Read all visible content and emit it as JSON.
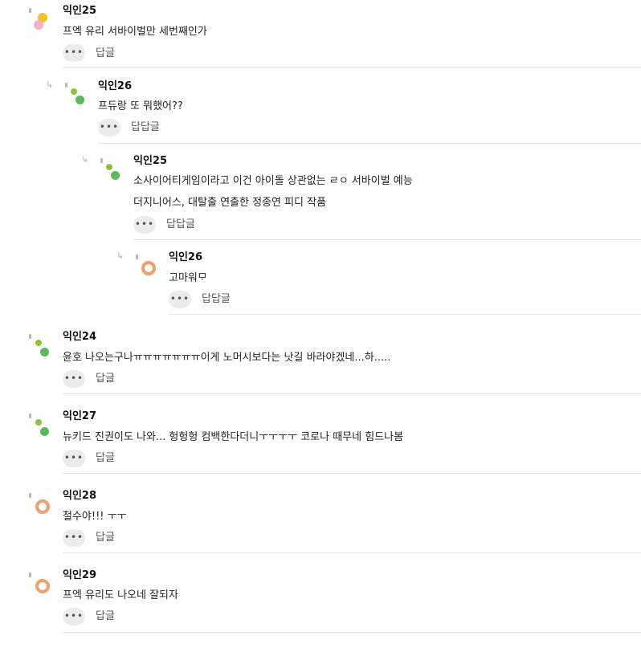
{
  "more_icon_glyph": "•••",
  "reply_arrow_glyph": "↳",
  "colors": {
    "green": "#5cb85c",
    "lime": "#8fc33b",
    "orange": "#f0a06a",
    "yellow": "#f5c21b",
    "pink": "#f3b2c8"
  },
  "comments": [
    {
      "author": "익인25",
      "lines": [
        "프엑 유리 서바이벌만 세번째인가"
      ],
      "reply_label": "답글",
      "avatar": "yellow-pink"
    },
    {
      "author": "익인26",
      "lines": [
        "프듀랑 또 뭐했어??"
      ],
      "reply_label": "답답글",
      "avatar": "green-lime"
    },
    {
      "author": "익인25",
      "lines": [
        "소사이어티게임이라고 이건 아이돌 상관없는 ㄹㅇ 서바이벌 예능",
        "더지니어스, 대탈출 연출한 정종연 피디 작품"
      ],
      "reply_label": "답답글",
      "avatar": "green-lime"
    },
    {
      "author": "익인26",
      "lines": [
        "고마워ᄆᆞ"
      ],
      "reply_label": "답답글",
      "avatar": "orange"
    },
    {
      "author": "익인24",
      "lines": [
        "윤호 나오는구나ㅠㅠㅠㅠㅠㅠㅠ이게 노머시보다는 낫길 바라야겠네...하....."
      ],
      "reply_label": "답글",
      "avatar": "green-lime"
    },
    {
      "author": "익인27",
      "lines": [
        "뉴키드 진권이도 나와... 헝헝헝 컴백한다더니ㅜㅜㅜㅜ 코로나 때무네 힘드나봄"
      ],
      "reply_label": "답글",
      "avatar": "green-lime"
    },
    {
      "author": "익인28",
      "lines": [
        "철수야!!! ㅜㅜ"
      ],
      "reply_label": "답글",
      "avatar": "orange"
    },
    {
      "author": "익인29",
      "lines": [
        "프엑 유리도 나오네 잘되자"
      ],
      "reply_label": "답글",
      "avatar": "orange"
    }
  ]
}
